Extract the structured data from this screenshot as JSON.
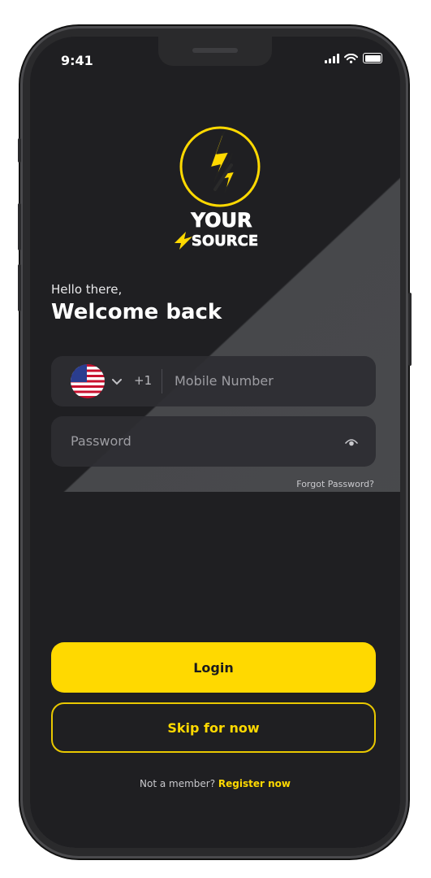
{
  "status_bar": {
    "time": "9:41"
  },
  "brand": {
    "logo_text_line1": "YOUR",
    "logo_text_line2": "SOURCE",
    "accent_color": "#FFD900"
  },
  "login": {
    "greeting": "Hello there,",
    "title": "Welcome back",
    "country_flag": "us-flag-icon",
    "dial_code": "+1",
    "mobile_placeholder": "Mobile Number",
    "password_placeholder": "Password",
    "forgot_password": "Forgot Password?",
    "login_label": "Login",
    "skip_label": "Skip for now",
    "not_member": "Not a member?",
    "register_link": "Register now"
  },
  "icons": [
    "wifi-icon",
    "cellular-signal-icon",
    "battery-icon",
    "chevron-down-icon",
    "eye-icon"
  ]
}
